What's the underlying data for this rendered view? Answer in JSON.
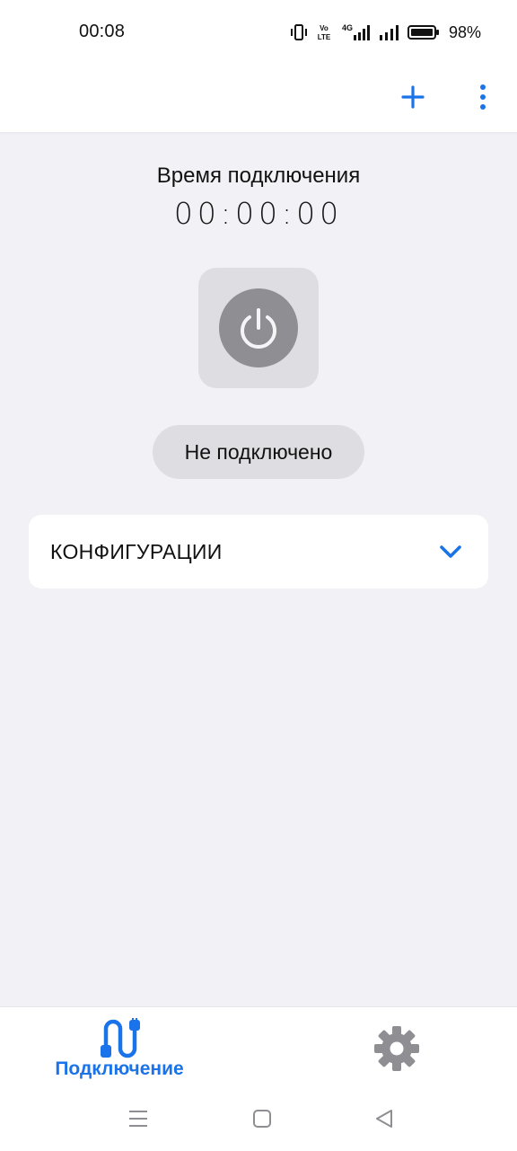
{
  "status_bar": {
    "time": "00:08",
    "battery": "98%",
    "network_label": "4G",
    "volte_label": "Vo LTE"
  },
  "header": {
    "actions": [
      "add-icon",
      "more-vert-icon"
    ]
  },
  "main": {
    "timer_title": "Время подключения",
    "timer_value": "00:00:00",
    "status_text": "Не подключено",
    "config_label": "КОНФИГУРАЦИИ"
  },
  "tab_bar": {
    "tabs": [
      {
        "label": "Подключение",
        "icon": "connection-cable-icon",
        "active": true
      },
      {
        "label": "",
        "icon": "gear-icon",
        "active": false
      }
    ]
  },
  "colors": {
    "accent": "#1a73e8",
    "background": "#f1f1f6",
    "tile": "#dddde2",
    "power": "#8e8e93"
  }
}
